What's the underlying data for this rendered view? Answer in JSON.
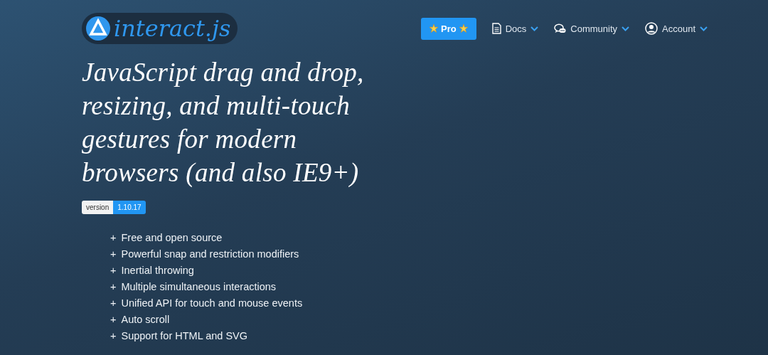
{
  "logo": {
    "text": "interact.js"
  },
  "nav": [
    {
      "kind": "pro",
      "label": "Pro"
    },
    {
      "kind": "docs",
      "label": "Docs"
    },
    {
      "kind": "community",
      "label": "Community"
    },
    {
      "kind": "account",
      "label": "Account"
    }
  ],
  "headline": "JavaScript drag and drop, resizing, and multi-touch gestures for modern browsers (and also IE9+)",
  "version_badge": {
    "label": "version",
    "value": "1.10.17"
  },
  "features": [
    {
      "marker": "+",
      "text": "Free and open source"
    },
    {
      "marker": "+",
      "text": "Powerful snap and restriction modifiers"
    },
    {
      "marker": "+",
      "text": "Inertial throwing"
    },
    {
      "marker": "+",
      "text": "Multiple simultaneous interactions"
    },
    {
      "marker": "+",
      "text": "Unified API for touch and mouse events"
    },
    {
      "marker": "+",
      "text": "Auto scroll"
    },
    {
      "marker": "+",
      "text": "Support for HTML and SVG"
    }
  ]
}
